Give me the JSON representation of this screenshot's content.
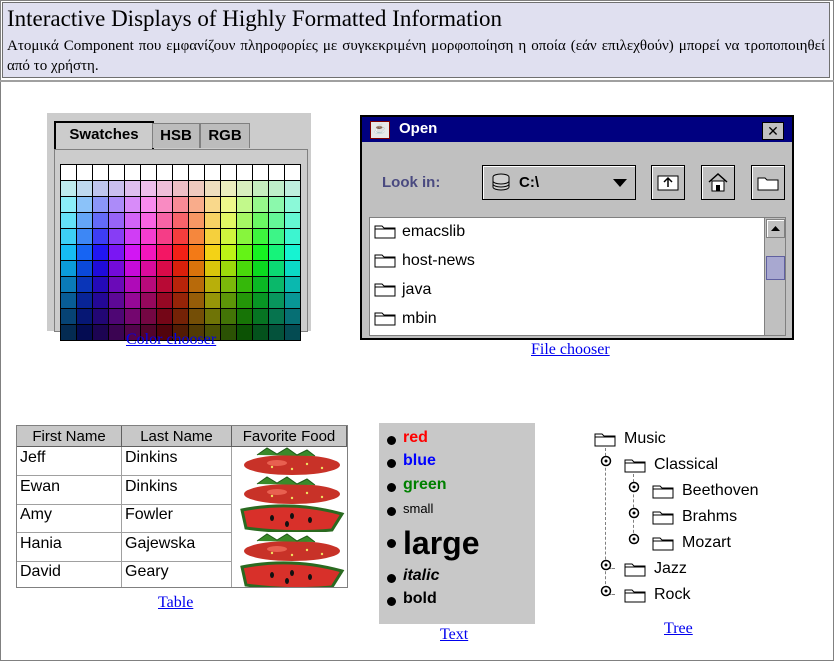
{
  "header": {
    "title": "Interactive Displays of Highly Formatted Information",
    "description": "Ατομικά Component που εμφανίζουν πληροφορίες με συγκεκριμένη μορφοποίηση η οποία (εάν επιλεχθούν) μπορεί να τροποποιηθεί από το χρήστη."
  },
  "color_chooser": {
    "tabs": [
      "Swatches",
      "HSB",
      "RGB"
    ],
    "selected_tab": "Swatches",
    "caption": "Color chooser"
  },
  "file_chooser": {
    "title": "Open",
    "close_glyph": "✕",
    "look_in_label": "Look in:",
    "look_in_value": "C:\\",
    "files": [
      "emacslib",
      "host-news",
      "java",
      "mbin"
    ],
    "caption": "File chooser",
    "buttons": [
      "up-folder-icon",
      "home-icon",
      "new-folder-icon"
    ]
  },
  "table": {
    "columns": [
      "First Name",
      "Last Name",
      "Favorite Food"
    ],
    "rows": [
      {
        "first": "Jeff",
        "last": "Dinkins",
        "food": "strawberry"
      },
      {
        "first": "Ewan",
        "last": "Dinkins",
        "food": "strawberry"
      },
      {
        "first": "Amy",
        "last": "Fowler",
        "food": "watermelon"
      },
      {
        "first": "Hania",
        "last": "Gajewska",
        "food": "strawberry"
      },
      {
        "first": "David",
        "last": "Geary",
        "food": "watermelon"
      }
    ],
    "caption": "Table"
  },
  "text": {
    "items": [
      {
        "label": "red",
        "color": "#ff0000"
      },
      {
        "label": "blue",
        "color": "#0000ff"
      },
      {
        "label": "green",
        "color": "#008000"
      },
      {
        "label": "small",
        "color": "#000000"
      },
      {
        "label": "large",
        "color": "#000000"
      },
      {
        "label": "italic",
        "color": "#000000"
      },
      {
        "label": "bold",
        "color": "#000000"
      }
    ],
    "caption": "Text"
  },
  "tree": {
    "root": "Music",
    "nodes": [
      "Classical",
      "Beethoven",
      "Brahms",
      "Mozart",
      "Jazz",
      "Rock"
    ],
    "caption": "Tree"
  }
}
